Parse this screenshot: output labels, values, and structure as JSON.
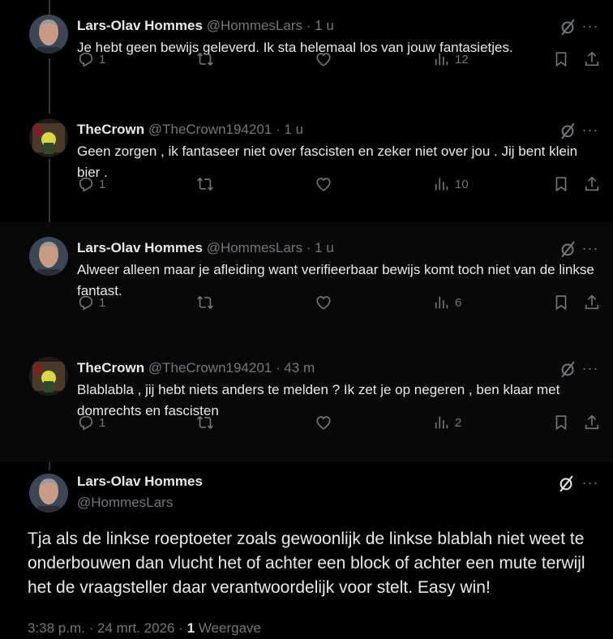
{
  "replies": [
    {
      "name": "Lars-Olav Hommes",
      "handle": "@HommesLars",
      "time": "1 u",
      "text": "Je hebt geen bewijs geleverd. Ik sta helemaal los van jouw fantasietjes.",
      "replies_count": "1",
      "views": "12"
    },
    {
      "name": "TheCrown",
      "handle": "@TheCrown194201",
      "time": "1 u",
      "text": "Geen zorgen , ik fantaseer niet over fascisten en zeker niet over jou . Jij bent klein bier .",
      "replies_count": "1",
      "views": "10"
    },
    {
      "name": "Lars-Olav Hommes",
      "handle": "@HommesLars",
      "time": "1 u",
      "text": "Alweer alleen maar je afleiding want verifieerbaar bewijs komt toch niet van de linkse fantast.",
      "replies_count": "1",
      "views": "6"
    },
    {
      "name": "TheCrown",
      "handle": "@TheCrown194201",
      "time": "43 m",
      "text": "Blablabla , jij hebt niets anders te melden ?  Ik zet je op negeren , ben klaar met domrechts en fascisten",
      "replies_count": "1",
      "views": "2"
    }
  ],
  "main": {
    "name": "Lars-Olav Hommes",
    "handle": "@HommesLars",
    "text": "Tja als de linkse roeptoeter zoals gewoonlijk de linkse blablah niet weet te onderbouwen dan vlucht het of achter een block of achter een mute terwijl het de vraagsteller daar verantwoordelijk voor stelt. Easy win!",
    "time": "3:38 p.m.",
    "date": "24 mrt. 2026",
    "view_count": "1",
    "view_label": "Weergave"
  },
  "separator": "·",
  "more_glyph": "···",
  "icons": {
    "reply": "reply-icon",
    "repost": "repost-icon",
    "like": "heart-icon",
    "views": "views-icon",
    "bookmark": "bookmark-icon",
    "share": "share-icon",
    "grok": "grok-icon",
    "more": "more-icon"
  },
  "colors": {
    "background": "#000000",
    "text": "#e7e9ea",
    "muted": "#71767b",
    "thread_line": "#333639"
  }
}
